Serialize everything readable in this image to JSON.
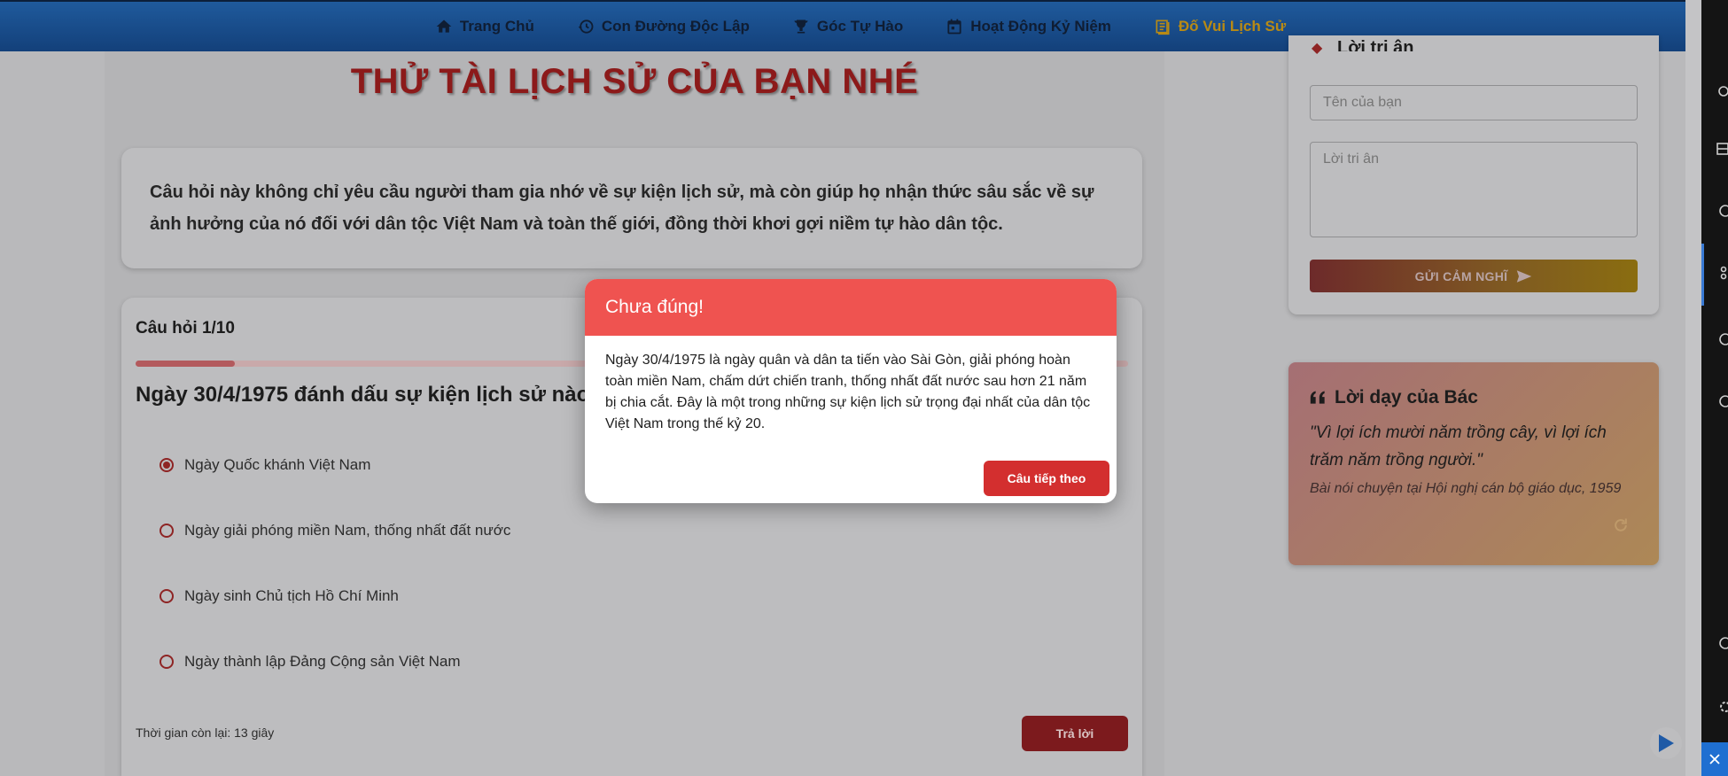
{
  "nav": {
    "items": [
      {
        "label": "Trang Chủ",
        "icon": "home-icon"
      },
      {
        "label": "Con Đường Độc Lập",
        "icon": "history-icon"
      },
      {
        "label": "Góc Tự Hào",
        "icon": "trophy-icon"
      },
      {
        "label": "Hoạt Động Kỷ Niệm",
        "icon": "calendar-icon"
      },
      {
        "label": "Đố Vui Lịch Sử",
        "icon": "book-icon",
        "active": true
      }
    ]
  },
  "page": {
    "title": "THỬ TÀI LỊCH SỬ CỦA BẠN NHÉ",
    "intro": "Câu hỏi này không chỉ yêu cầu người tham gia nhớ về sự kiện lịch sử, mà còn giúp họ nhận thức sâu sắc về sự ảnh hưởng của nó đối với dân tộc Việt Nam và toàn thế giới, đồng thời khơi gợi niềm tự hào dân tộc."
  },
  "quiz": {
    "counter": "Câu hỏi 1/10",
    "progress_fraction": 0.1,
    "question": "Ngày 30/4/1975 đánh dấu sự kiện lịch sử nào",
    "options": [
      {
        "label": "Ngày Quốc khánh Việt Nam",
        "selected": true
      },
      {
        "label": "Ngày giải phóng miền Nam, thống nhất đất nước",
        "selected": false
      },
      {
        "label": "Ngày sinh Chủ tịch Hồ Chí Minh",
        "selected": false
      },
      {
        "label": "Ngày thành lập Đảng Cộng sản Việt Nam",
        "selected": false
      }
    ],
    "timer": "Thời gian còn lại: 13 giây",
    "answer_label": "Trả lời"
  },
  "thanks": {
    "heading": "Lời tri ân",
    "name_placeholder": "Tên của bạn",
    "message_placeholder": "Lời tri ân",
    "send_label": "GỬI CẢM NGHĨ"
  },
  "teaching": {
    "title": "Lời dạy của Bác",
    "quote": "\"Vì lợi ích mười năm trồng cây, vì lợi ích trăm năm trồng người.\"",
    "source": "Bài nói chuyện tại Hội nghị cán bộ giáo dục, 1959"
  },
  "modal": {
    "title": "Chưa đúng!",
    "body": "Ngày 30/4/1975 là ngày quân và dân ta tiến vào Sài Gòn, giải phóng hoàn toàn miền Nam, chấm dứt chiến tranh, thống nhất đất nước sau hơn 21 năm bị chia cắt. Đây là một trong những sự kiện lịch sử trọng đại nhất của dân tộc Việt Nam trong thế kỷ 20.",
    "next_label": "Câu tiếp theo"
  },
  "colors": {
    "modal_header": "#ef5350",
    "primary_red": "#d32f2f",
    "nav_active": "#b88a14"
  }
}
